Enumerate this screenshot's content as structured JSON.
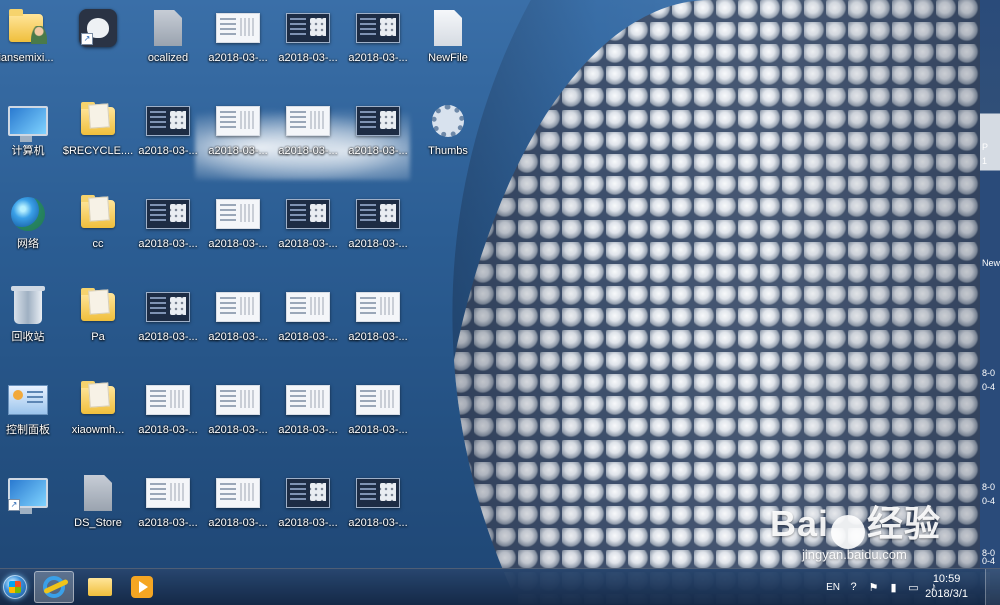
{
  "desktop": {
    "icons": [
      {
        "label": "iansemixi..."
      },
      {
        "label": ""
      },
      {
        "label": "ocalized"
      },
      {
        "label": "a2018-03-..."
      },
      {
        "label": "a2018-03-..."
      },
      {
        "label": "a2018-03-..."
      },
      {
        "label": "NewFile"
      },
      {
        "label": "计算机"
      },
      {
        "label": "$RECYCLE...."
      },
      {
        "label": "a2018-03-..."
      },
      {
        "label": "a2018-03-..."
      },
      {
        "label": "a2018-03-..."
      },
      {
        "label": "a2018-03-..."
      },
      {
        "label": "Thumbs"
      },
      {
        "label": "网络"
      },
      {
        "label": "cc"
      },
      {
        "label": "a2018-03-..."
      },
      {
        "label": "a2018-03-..."
      },
      {
        "label": "a2018-03-..."
      },
      {
        "label": "a2018-03-..."
      },
      {
        "label": "回收站"
      },
      {
        "label": "Pa"
      },
      {
        "label": "a2018-03-..."
      },
      {
        "label": "a2018-03-..."
      },
      {
        "label": "a2018-03-..."
      },
      {
        "label": "a2018-03-..."
      },
      {
        "label": "控制面板"
      },
      {
        "label": "xiaowmh..."
      },
      {
        "label": "a2018-03-..."
      },
      {
        "label": "a2018-03-..."
      },
      {
        "label": "a2018-03-..."
      },
      {
        "label": "a2018-03-..."
      },
      {
        "label": ""
      },
      {
        "label": "DS_Store"
      },
      {
        "label": "a2018-03-..."
      },
      {
        "label": "a2018-03-..."
      },
      {
        "label": "a2018-03-..."
      },
      {
        "label": "a2018-03-..."
      }
    ]
  },
  "right_strip": {
    "fragments": [
      "P",
      "1",
      "New",
      "8-0",
      "0-4",
      "8-0",
      "0-4",
      "8-0",
      "0-4"
    ]
  },
  "watermark": {
    "brand_left": "Bai",
    "brand_right": "经验",
    "url": "jingyan.baidu.com"
  },
  "taskbar": {
    "language": "EN",
    "time": "10:59",
    "date": "2018/3/1"
  },
  "colors": {
    "taskbar": "#1f3a5e",
    "desktop_blue": "#2b5d93"
  }
}
